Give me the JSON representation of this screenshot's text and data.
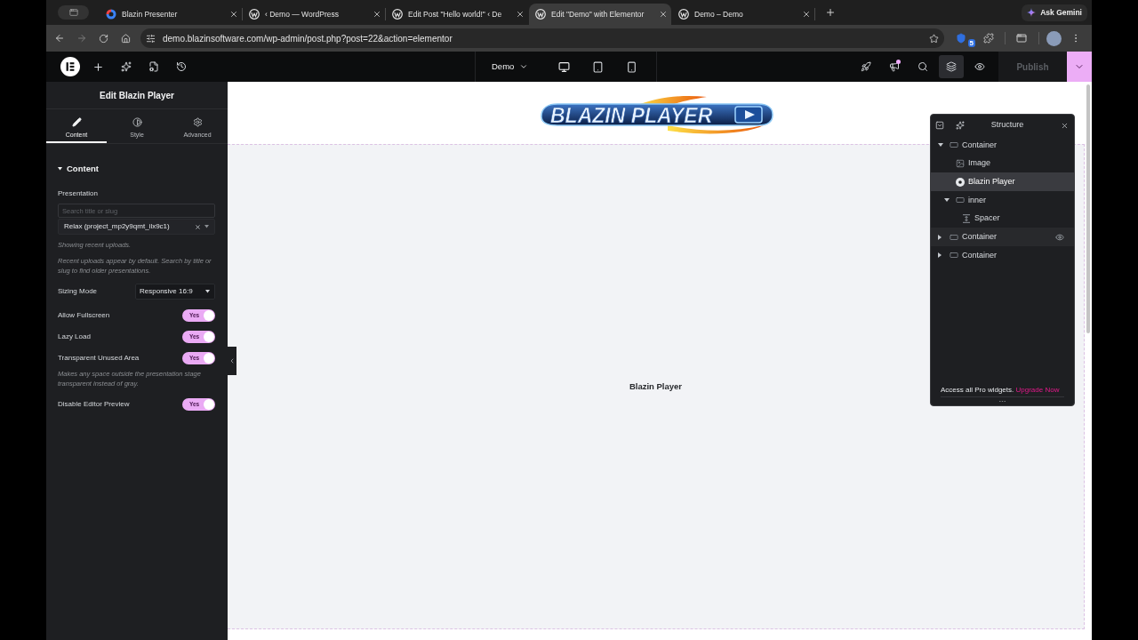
{
  "browser": {
    "tabs": [
      {
        "title": "Blazin Presenter",
        "kind": "swirl",
        "selected": false
      },
      {
        "title": "‹ Demo — WordPress",
        "kind": "ring",
        "selected": false
      },
      {
        "title": "Edit Post \"Hello world!\" ‹ De",
        "kind": "ring",
        "selected": false
      },
      {
        "title": "Edit \"Demo\" with Elementor",
        "kind": "ring",
        "selected": true
      },
      {
        "title": "Demo – Demo",
        "kind": "ring",
        "selected": false
      }
    ],
    "assistant_button": "Ask Gemini",
    "address": "demo.blazinsoftware.com/wp-admin/post.php?post=22&action=elementor",
    "extension_badge": "5"
  },
  "editor": {
    "top_bar": {
      "page_menu": "Demo",
      "tools": [
        {
          "kind": "rocket",
          "selected": false,
          "notification": false
        },
        {
          "kind": "megaphone",
          "selected": false,
          "notification": true
        },
        {
          "kind": "search",
          "selected": false,
          "notification": false
        },
        {
          "kind": "layers",
          "selected": true,
          "notification": false
        },
        {
          "kind": "preview",
          "selected": false,
          "notification": false
        }
      ],
      "publish": {
        "label": "Publish",
        "disabled": true
      }
    },
    "panel": {
      "title": "Edit Blazin Player",
      "tabs": [
        {
          "label": "Content",
          "kind": "pencil",
          "selected": true
        },
        {
          "label": "Style",
          "kind": "contrast",
          "selected": false
        },
        {
          "label": "Advanced",
          "kind": "gear",
          "selected": false
        }
      ],
      "section": {
        "title": "Content",
        "expanded": true
      },
      "presentation": {
        "label": "Presentation",
        "search_placeholder": "Search title or slug",
        "value": "Relax (project_mp2y9qmt_ilx9c1)",
        "notes": [
          "Showing recent uploads.",
          "Recent uploads appear by default. Search by title or slug to find older presentations."
        ]
      },
      "sizing_mode": {
        "label": "Sizing Mode",
        "value": "Responsive 16:9"
      },
      "switches": [
        {
          "label": "Allow Fullscreen",
          "on": true,
          "state_text": "Yes"
        },
        {
          "label": "Lazy Load",
          "on": true,
          "state_text": "Yes"
        },
        {
          "label": "Transparent Unused Area",
          "on": true,
          "state_text": "Yes",
          "note": "Makes any space outside the presentation stage transparent instead of gray."
        },
        {
          "label": "Disable Editor Preview",
          "on": true,
          "state_text": "Yes"
        }
      ]
    },
    "canvas": {
      "logo_text": "BLAZIN PLAYER",
      "widget_label": "Blazin Player"
    },
    "structure": {
      "title": "Structure",
      "tree": [
        {
          "label": "Container",
          "kind": "container",
          "expanded": true,
          "selected": false,
          "hovered": false,
          "children": [
            {
              "label": "Image",
              "kind": "image",
              "selected": false,
              "hovered": false
            },
            {
              "label": "Blazin Player",
              "kind": "player",
              "selected": true,
              "hovered": false
            },
            {
              "label": "inner",
              "kind": "container",
              "expanded": true,
              "selected": false,
              "hovered": false,
              "children": [
                {
                  "label": "Spacer",
                  "kind": "spacer",
                  "selected": false,
                  "hovered": false
                }
              ]
            }
          ]
        },
        {
          "label": "Container",
          "kind": "container",
          "expanded": false,
          "selected": false,
          "hovered": true
        },
        {
          "label": "Container",
          "kind": "container",
          "expanded": false,
          "selected": false,
          "hovered": false
        }
      ],
      "promo": {
        "text": "Access all Pro widgets.",
        "link": "Upgrade Now"
      }
    }
  }
}
